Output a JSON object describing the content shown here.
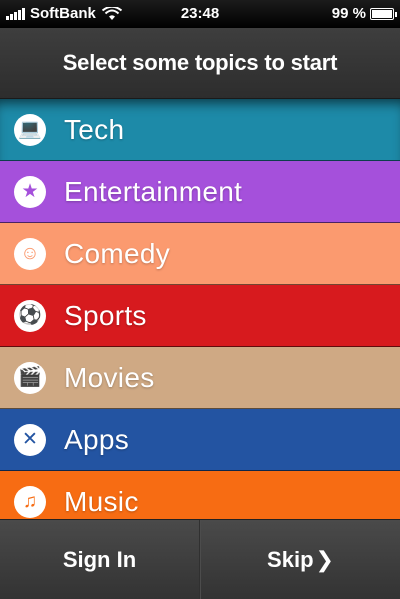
{
  "status_bar": {
    "carrier": "SoftBank",
    "time": "23:48",
    "battery": "99 %",
    "battery_level": 0.99
  },
  "header": {
    "title": "Select some topics to start"
  },
  "topics": [
    {
      "label": "Tech",
      "color": "#1d8aa8",
      "icon": "laptop-icon",
      "glyph": "💻"
    },
    {
      "label": "Entertainment",
      "color": "#a550db",
      "icon": "stars-icon",
      "glyph": "★"
    },
    {
      "label": "Comedy",
      "color": "#fb9a6f",
      "icon": "smiley-icon",
      "glyph": "☺"
    },
    {
      "label": "Sports",
      "color": "#d71a1e",
      "icon": "soccer-ball-icon",
      "glyph": "⚽"
    },
    {
      "label": "Movies",
      "color": "#cfa984",
      "icon": "clapperboard-icon",
      "glyph": "🎬"
    },
    {
      "label": "Apps",
      "color": "#2354a2",
      "icon": "apps-icon",
      "glyph": "✕"
    },
    {
      "label": "Music",
      "color": "#f76c13",
      "icon": "music-note-icon",
      "glyph": "♫"
    }
  ],
  "footer": {
    "sign_in": "Sign In",
    "skip": "Skip",
    "skip_chevron": "❯"
  }
}
